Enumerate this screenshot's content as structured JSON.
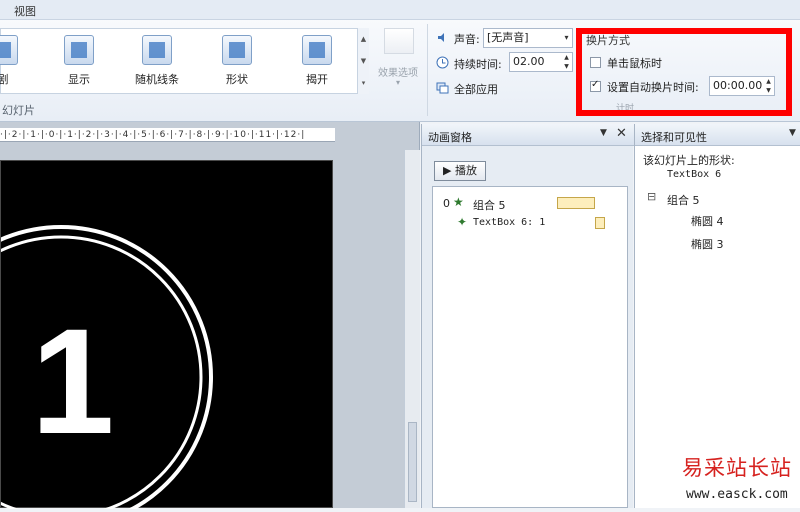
{
  "ribbon": {
    "tab_view": "视图",
    "transitions": [
      {
        "label": "剧",
        "icon": "transition-icon"
      },
      {
        "label": "显示",
        "icon": "reveal-icon"
      },
      {
        "label": "随机线条",
        "icon": "random-bars-icon"
      },
      {
        "label": "形状",
        "icon": "shape-icon"
      },
      {
        "label": "揭开",
        "icon": "uncover-icon"
      }
    ],
    "effect_options": "效果选项",
    "group_label": "幻灯片",
    "sound_label": "声音:",
    "sound_value": "[无声音]",
    "duration_label": "持续时间:",
    "duration_value": "02.00",
    "apply_all_label": "全部应用",
    "advance_title": "换片方式",
    "on_click_label": "单击鼠标时",
    "on_click_checked": false,
    "after_label": "设置自动换片时间:",
    "after_checked": true,
    "after_value": "00:00.00",
    "timing_footer": "计时"
  },
  "ruler": {
    "text": "·|·2·|·1·|·0·|·1·|·2·|·3·|·4·|·5·|·6·|·7·|·8·|·9·|·10·|·11·|·12·|"
  },
  "slide": {
    "number_text": "1"
  },
  "animation_pane": {
    "title": "动画窗格",
    "play_label": "▶ 播放",
    "items": [
      {
        "num": "0",
        "name": "组合 5",
        "indent": 0
      },
      {
        "num": "",
        "name": "TextBox 6: 1",
        "indent": 1
      }
    ]
  },
  "selection_pane": {
    "title": "选择和可见性",
    "subtitle": "该幻灯片上的形状:",
    "items": [
      {
        "label": "TextBox 6",
        "indent": 0
      },
      {
        "label": "组合 5",
        "indent": 0,
        "expander": "⊟"
      },
      {
        "label": "椭圆 4",
        "indent": 1
      },
      {
        "label": "椭圆 3",
        "indent": 1
      }
    ]
  },
  "watermark": {
    "title": "易采站长站",
    "url": "www.easck.com"
  },
  "colors": {
    "highlight": "#ff0000",
    "watermark": "#d6221f",
    "slide_bg": "#000000"
  }
}
